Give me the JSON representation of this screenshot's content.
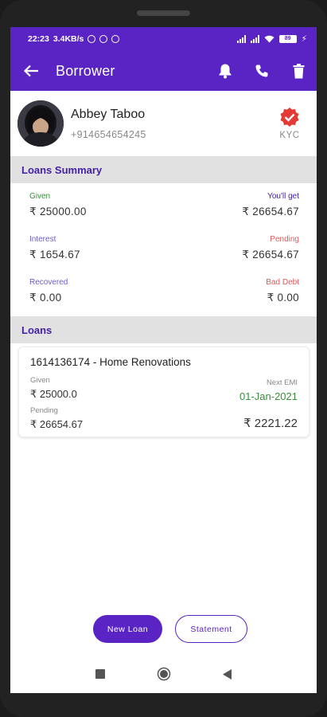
{
  "status_bar": {
    "time": "22:23",
    "net_speed": "3.4KB/s",
    "battery": "89"
  },
  "app_bar": {
    "title": "Borrower"
  },
  "profile": {
    "name": "Abbey Taboo",
    "phone": "+914654654245",
    "kyc_label": "KYC"
  },
  "summary": {
    "header": "Loans Summary",
    "given_label": "Given",
    "given_value": "₹ 25000.00",
    "youll_get_label": "You'll get",
    "youll_get_value": "₹ 26654.67",
    "interest_label": "Interest",
    "interest_value": "₹ 1654.67",
    "pending_label": "Pending",
    "pending_value": "₹ 26654.67",
    "recovered_label": "Recovered",
    "recovered_value": "₹ 0.00",
    "bad_debt_label": "Bad Debt",
    "bad_debt_value": "₹ 0.00"
  },
  "loans": {
    "header": "Loans",
    "items": [
      {
        "title": "1614136174 - Home Renovations",
        "given_label": "Given",
        "given_value": "₹ 25000.0",
        "next_emi_label": "Next EMI",
        "next_emi_date": "01-Jan-2021",
        "pending_label": "Pending",
        "pending_value": "₹ 26654.67",
        "emi_amount": "₹ 2221.22"
      }
    ]
  },
  "actions": {
    "new_loan": "New Loan",
    "statement": "Statement"
  },
  "colors": {
    "primary": "#5a24c4",
    "given": "#3a8f3a",
    "youll_get": "#4521a6",
    "interest": "#6a5fc7",
    "pending": "#e05a5a",
    "recovered": "#6a5fc7",
    "bad_debt": "#e05a5a",
    "kyc_badge": "#e53935"
  }
}
